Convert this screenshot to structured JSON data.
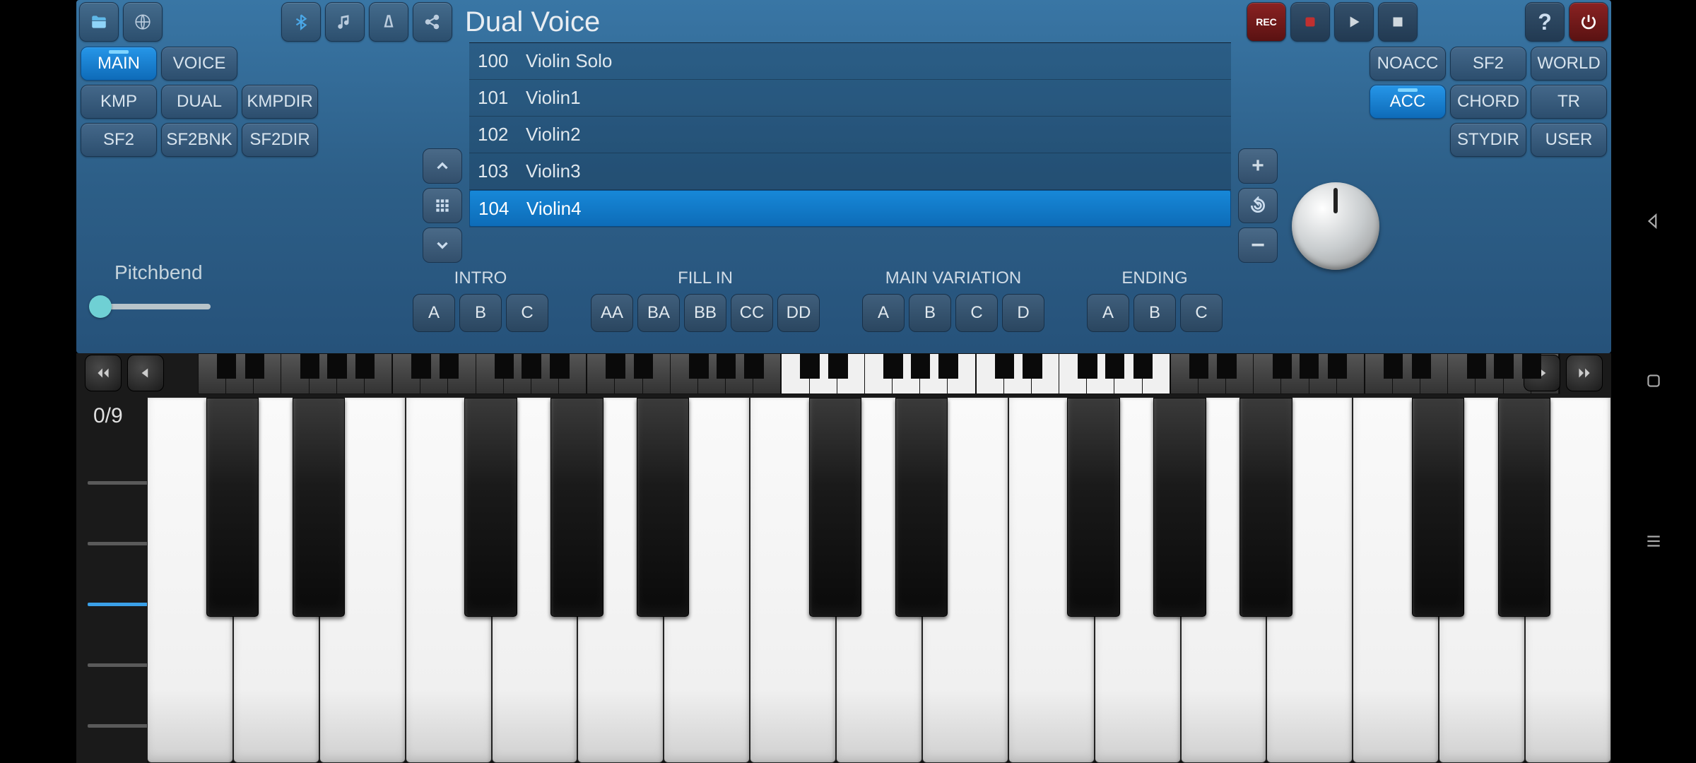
{
  "title": "Dual Voice",
  "top_icons_left": {
    "folder": "folder-icon",
    "globe": "globe-icon",
    "bluetooth": "bluetooth-icon",
    "music": "music-icon",
    "metronome": "metronome-icon",
    "share": "share-icon"
  },
  "top_icons_right": {
    "rec": "REC",
    "stop": "stop-icon",
    "play": "play-icon",
    "pause": "pause-icon",
    "help": "?",
    "power": "power-icon"
  },
  "left_tabs": [
    {
      "label": "MAIN",
      "active": true
    },
    {
      "label": "VOICE",
      "active": false
    },
    {
      "label": "KMP",
      "active": false
    },
    {
      "label": "DUAL",
      "active": false
    },
    {
      "label": "KMPDIR",
      "active": false
    },
    {
      "label": "SF2",
      "active": false
    },
    {
      "label": "SF2BNK",
      "active": false
    },
    {
      "label": "SF2DIR",
      "active": false
    }
  ],
  "right_tabs": [
    {
      "label": "NOACC",
      "active": false
    },
    {
      "label": "SF2",
      "active": false
    },
    {
      "label": "WORLD",
      "active": false
    },
    {
      "label": "ACC",
      "active": true
    },
    {
      "label": "CHORD",
      "active": false
    },
    {
      "label": "TR",
      "active": false
    },
    {
      "label": "STYDIR",
      "active": false
    },
    {
      "label": "USER",
      "active": false
    }
  ],
  "voices": [
    {
      "num": "100",
      "name": "Violin Solo",
      "selected": false
    },
    {
      "num": "101",
      "name": "Violin1",
      "selected": false
    },
    {
      "num": "102",
      "name": "Violin2",
      "selected": false
    },
    {
      "num": "103",
      "name": "Violin3",
      "selected": false
    },
    {
      "num": "104",
      "name": "Violin4",
      "selected": true
    }
  ],
  "pitchbend_label": "Pitchbend",
  "sections": {
    "intro": {
      "label": "INTRO",
      "btns": [
        "A",
        "B",
        "C"
      ]
    },
    "fillin": {
      "label": "FILL IN",
      "btns": [
        "AA",
        "BA",
        "BB",
        "CC",
        "DD"
      ]
    },
    "mainvar": {
      "label": "MAIN VARIATION",
      "btns": [
        "A",
        "B",
        "C",
        "D"
      ]
    },
    "ending": {
      "label": "ENDING",
      "btns": [
        "A",
        "B",
        "C"
      ]
    }
  },
  "octave_label": "0/9",
  "mini_highlight_range": [
    3,
    4
  ],
  "velocity_bars": 5,
  "velocity_active": 2
}
